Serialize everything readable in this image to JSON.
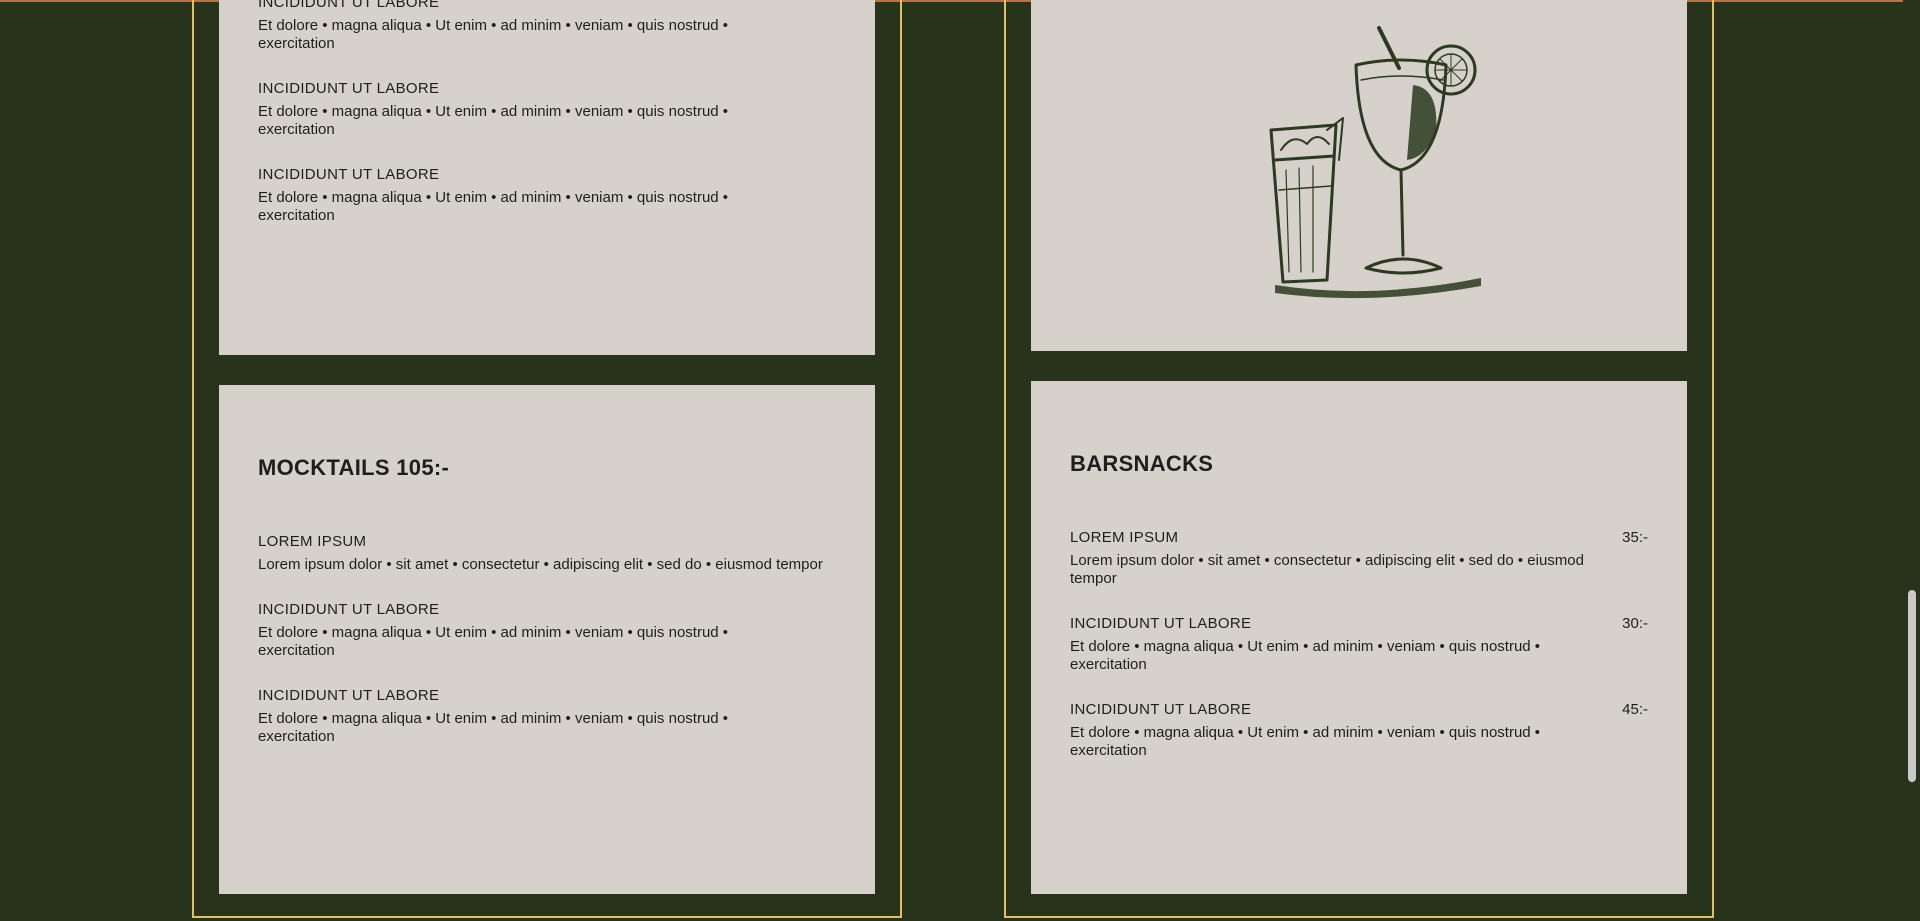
{
  "colors": {
    "page_background": "#27331a",
    "card_background": "#d6d2cb",
    "column_border": "#e2c05e",
    "top_accent": "#c2703d"
  },
  "top_left_card": {
    "items": [
      {
        "name": "INCIDIDUNT UT LABORE",
        "desc": "Et dolore • magna aliqua • Ut enim • ad minim • veniam • quis nostrud • exercitation"
      },
      {
        "name": "INCIDIDUNT UT LABORE",
        "desc": "Et dolore • magna aliqua • Ut enim • ad minim • veniam • quis nostrud • exercitation"
      },
      {
        "name": "INCIDIDUNT UT LABORE",
        "desc": "Et dolore • magna aliqua • Ut enim • ad minim • veniam • quis nostrud • exercitation"
      }
    ]
  },
  "mocktails": {
    "title": "MOCKTAILS 105:-",
    "items": [
      {
        "name": "LOREM IPSUM",
        "desc": "Lorem ipsum dolor • sit amet • consectetur • adipiscing elit • sed do • eiusmod tempor"
      },
      {
        "name": "INCIDIDUNT UT LABORE",
        "desc": "Et dolore • magna aliqua • Ut enim • ad minim • veniam • quis nostrud • exercitation"
      },
      {
        "name": "INCIDIDUNT UT LABORE",
        "desc": "Et dolore • magna aliqua • Ut enim • ad minim • veniam • quis nostrud • exercitation"
      }
    ]
  },
  "illustration": {
    "icon": "cocktail-glasses-illustration"
  },
  "barsnacks": {
    "title": "BARSNACKS",
    "items": [
      {
        "name": "LOREM IPSUM",
        "price": "35:-",
        "desc": "Lorem ipsum dolor • sit amet • consectetur • adipiscing elit • sed do • eiusmod tempor"
      },
      {
        "name": "INCIDIDUNT UT LABORE",
        "price": "30:-",
        "desc": "Et dolore • magna aliqua • Ut enim • ad minim • veniam • quis nostrud • exercitation"
      },
      {
        "name": "INCIDIDUNT UT LABORE",
        "price": "45:-",
        "desc": "Et dolore • magna aliqua • Ut enim • ad minim • veniam • quis nostrud • exercitation"
      }
    ]
  }
}
